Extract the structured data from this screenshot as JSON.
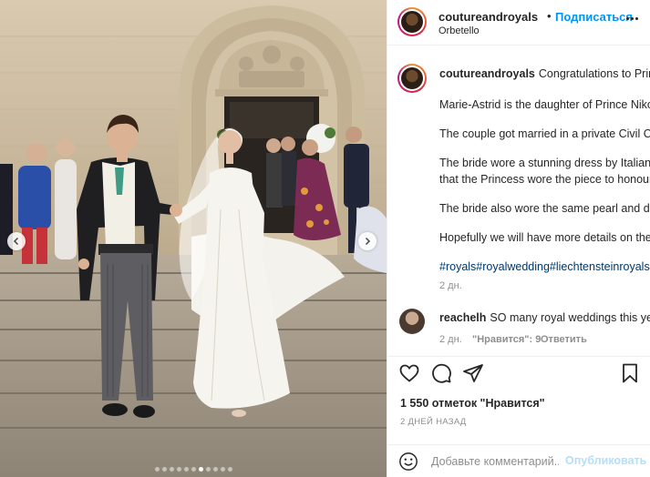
{
  "post": {
    "username": "coutureandroyals",
    "follow_label": "Подписаться",
    "separator": "•",
    "location": "Orbetello",
    "more_icon": "more-horizontal-icon"
  },
  "media": {
    "alt": "Wedding couple walking down church steps",
    "carousel_dots_count": 11,
    "carousel_active_index": 6,
    "prev_icon": "chevron-left-icon",
    "next_icon": "chevron-right-icon"
  },
  "caption": {
    "username": "coutureandroyals",
    "lines": [
      "Congratulations to Princ",
      "Marie-Astrid is the daughter of Prince Niko",
      "The couple got married in a private Civil Ce",
      "The bride wore a stunning dress by Italian d",
      "that the Princess wore the piece to honour",
      "The bride also wore the same pearl and dia",
      "Hopefully we will have more details on the"
    ],
    "hashtags": "#royals#royalwedding#liechtensteinroyals#",
    "time": "2 дн."
  },
  "reply": {
    "username": "reachelh",
    "text": "SO many royal weddings this year",
    "time": "2 дн.",
    "likes_label": "\"Нравится\": 9",
    "reply_label": "Ответить"
  },
  "actions": {
    "likes": "1 550 отметок \"Нравится\"",
    "date": "2 ДНЕЙ НАЗАД",
    "comment_placeholder": "Добавьте комментарий...",
    "publish_label": "Опубликовать"
  },
  "colors": {
    "link_blue": "#0095f6",
    "publish_disabled": "#b2dffc",
    "hashtag": "#00376b",
    "secondary_text": "#8e8e8e"
  }
}
